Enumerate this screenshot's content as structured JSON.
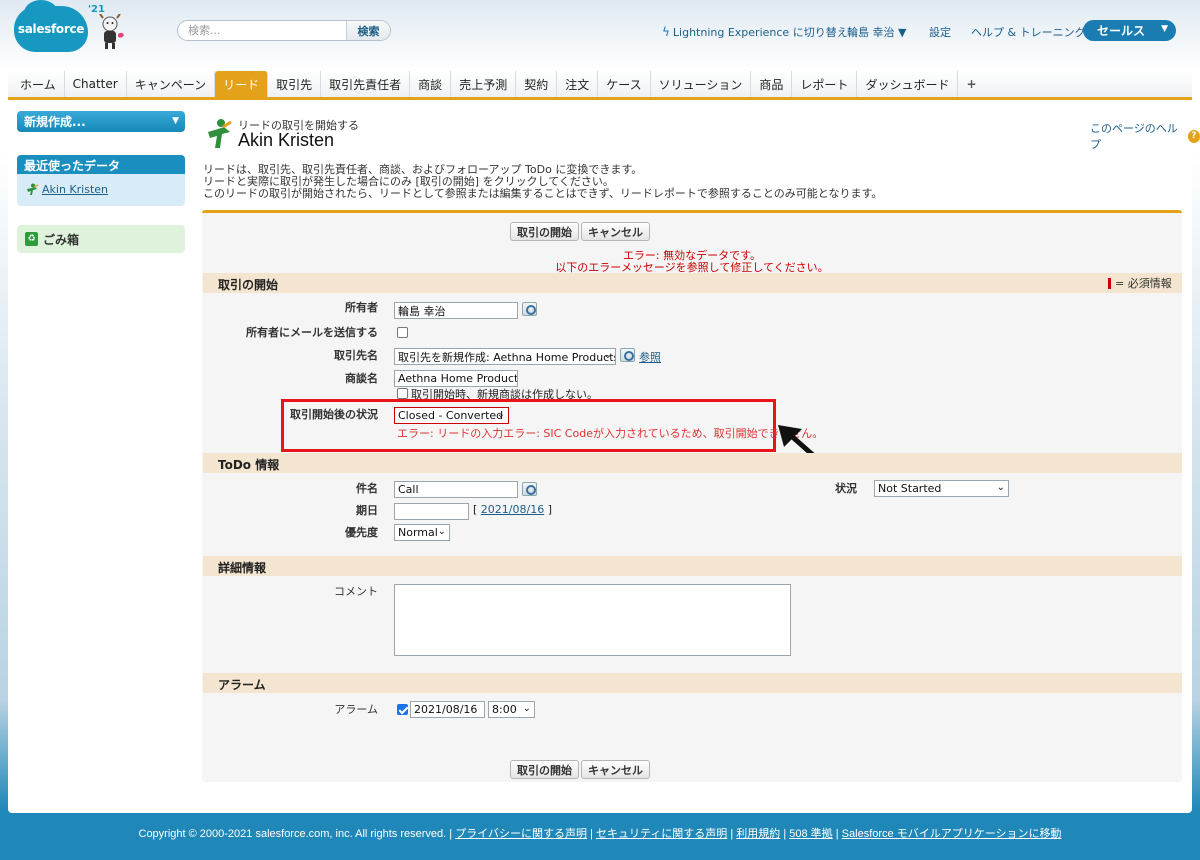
{
  "header": {
    "logo_text": "salesforce",
    "release": "'21",
    "search_placeholder": "検索...",
    "search_button": "検索",
    "lightning_switch": "Lightning Experience に切り替え",
    "user_name": "輪島 幸治 ▼",
    "settings": "設定",
    "help_training": "ヘルプ & トレーニング",
    "app_menu": "セールス"
  },
  "tabs": [
    "ホーム",
    "Chatter",
    "キャンペーン",
    "リード",
    "取引先",
    "取引先責任者",
    "商談",
    "売上予測",
    "契約",
    "注文",
    "ケース",
    "ソリューション",
    "商品",
    "レポート",
    "ダッシュボード",
    "+"
  ],
  "active_tab": "リード",
  "sidebar": {
    "new_button": "新規作成...",
    "recent_title": "最近使ったデータ",
    "recent_item": "Akin Kristen",
    "recycle_bin": "ごみ箱"
  },
  "page": {
    "breadcrumb": "リードの取引を開始する",
    "title": "Akin Kristen",
    "help_link": "このページのヘルプ",
    "intro_1": "リードは、取引先、取引先責任者、商談、およびフォローアップ ToDo に変換できます。",
    "intro_2": "リードと実際に取引が発生した場合にのみ [取引の開始] をクリックしてください。",
    "intro_3": "このリードの取引が開始されたら、リードとして参照または編集することはできず、リードレポートで参照することのみ可能となります。"
  },
  "buttons": {
    "convert": "取引の開始",
    "cancel": "キャンセル"
  },
  "error": {
    "line1": "エラー: 無効なデータです。",
    "line2": "以下のエラーメッセージを参照して修正してください。",
    "field_error": "エラー: リードの入力エラー: SIC Codeが入力されているため、取引開始できません。"
  },
  "sections": {
    "convert": "取引の開始",
    "required_legend": "= 必須情報",
    "task": "ToDo 情報",
    "detail": "詳細情報",
    "reminder": "アラーム"
  },
  "fields": {
    "owner_label": "所有者",
    "owner_value": "輪島 幸治",
    "send_email_label": "所有者にメールを送信する",
    "account_label": "取引先名",
    "account_value": "取引先を新規作成: Aethna Home Products",
    "account_view_link": "参照",
    "opportunity_label": "商談名",
    "opportunity_value": "Aethna Home Products-",
    "no_opportunity_text": "取引開始時、新規商談は作成しない。",
    "converted_status_label": "取引開始後の状況",
    "converted_status_value": "Closed - Converted",
    "subject_label": "件名",
    "subject_value": "Call",
    "status_label": "状況",
    "status_value": "Not Started",
    "due_date_label": "期日",
    "due_date_link": "2021/08/16",
    "priority_label": "優先度",
    "priority_value": "Normal",
    "comment_label": "コメント",
    "reminder_label": "アラーム",
    "reminder_date": "2021/08/16",
    "reminder_time": "8:00"
  },
  "footer": {
    "copyright": "Copyright © 2000-2021 salesforce.com, inc. All rights reserved.",
    "privacy": "プライバシーに関する声明",
    "security": "セキュリティに関する声明",
    "terms": "利用規約",
    "compliance": "508 準拠",
    "mobile": "Salesforce モバイルアプリケーションに移動"
  },
  "colors": {
    "accent": "#e3a21a",
    "brand": "#1798c1",
    "error": "#e8141a"
  }
}
